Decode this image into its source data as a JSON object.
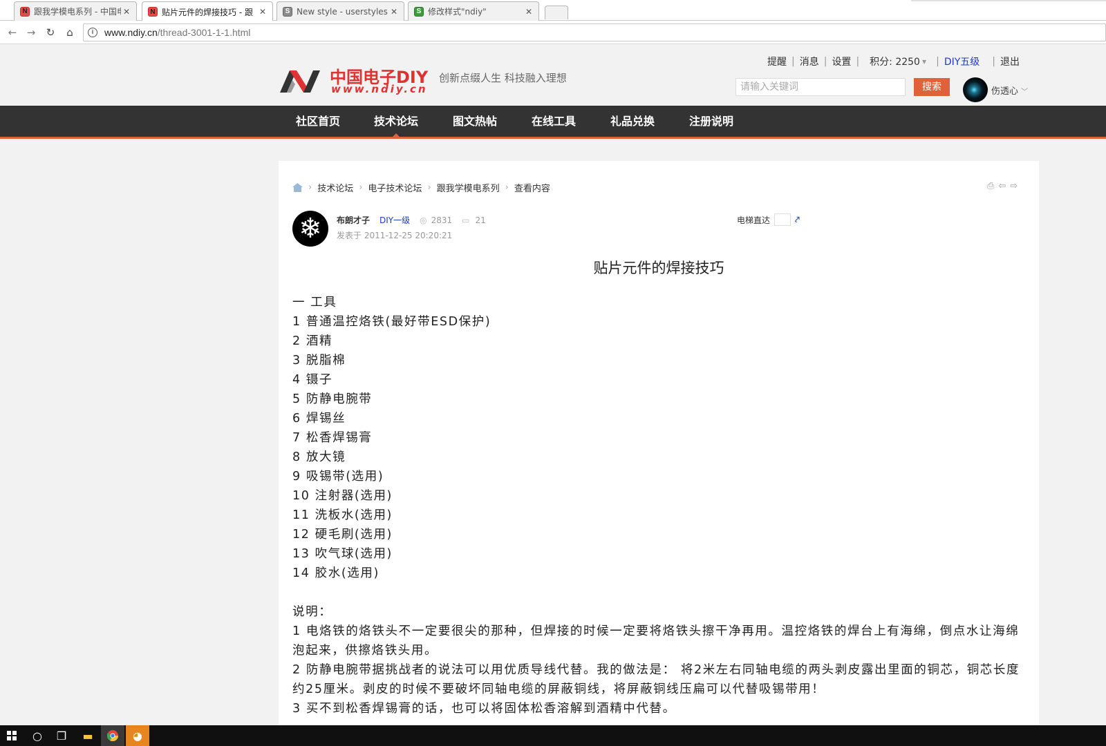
{
  "browser": {
    "tabs": [
      {
        "title": "跟我学模电系列 - 中国电",
        "icon": "n-favicon",
        "close": "✕"
      },
      {
        "title": "贴片元件的焊接技巧 - 跟",
        "icon": "n-favicon",
        "close": "✕"
      },
      {
        "title": "New style - userstyles.o",
        "icon": "stylish-favicon",
        "close": "✕"
      },
      {
        "title": "修改样式\"ndiy\"",
        "icon": "stylish-green-favicon",
        "close": "✕"
      }
    ],
    "url_host": "www.ndiy.cn",
    "url_path": "/thread-3001-1-1.html"
  },
  "header": {
    "logo_text": "中国电子DIY",
    "logo_sub": "www.ndiy.cn",
    "slogan": "创新点缀人生 科技融入理想",
    "links": [
      "提醒",
      "消息",
      "设置"
    ],
    "points_label": "积分: 2250",
    "level": "DIY五级",
    "logout": "退出",
    "search_placeholder": "请输入关键词",
    "search_button": "搜索",
    "username": "伤透心"
  },
  "nav": {
    "items": [
      "社区首页",
      "技术论坛",
      "图文热帖",
      "在线工具",
      "礼品兑换",
      "注册说明"
    ],
    "active": "技术论坛"
  },
  "breadcrumb": [
    "技术论坛",
    "电子技术论坛",
    "跟我学模电系列",
    "查看内容"
  ],
  "post": {
    "author": "布朗才子",
    "author_level": "DIY一级",
    "views": "2831",
    "replies": "21",
    "posted": "发表于 2011-12-25 20:20:21",
    "elevator_label": "电梯直达",
    "title": "贴片元件的焊接技巧",
    "lines": [
      "一 工具",
      "1 普通温控烙铁(最好带ESD保护)",
      "2 酒精",
      "3 脱脂棉",
      "4 镊子",
      "5 防静电腕带",
      "6 焊锡丝",
      "7 松香焊锡膏",
      "8 放大镜",
      "9 吸锡带(选用)",
      "10 注射器(选用)",
      "11 洗板水(选用)",
      "12 硬毛刷(选用)",
      "13 吹气球(选用)",
      "14 胶水(选用)"
    ],
    "notes_heading": "说明：",
    "notes": [
      "1 电烙铁的烙铁头不一定要很尖的那种，但焊接的时候一定要将烙铁头擦干净再用。温控烙铁的焊台上有海绵，倒点水让海绵泡起来，供擦烙铁头用。",
      "2 防静电腕带据挑战者的说法可以用优质导线代替。我的做法是： 将2米左右同轴电缆的两头剥皮露出里面的铜芯，铜芯长度约25厘米。剥皮的时候不要破坏同轴电缆的屏蔽铜线，将屏蔽铜线压扁可以代替吸锡带用！",
      "3 买不到松香焊锡膏的话，也可以将固体松香溶解到酒精中代替。"
    ]
  },
  "colors": {
    "accent": "#e0623a",
    "nav_bg": "#333333",
    "level_blue": "#1a3cc7"
  }
}
